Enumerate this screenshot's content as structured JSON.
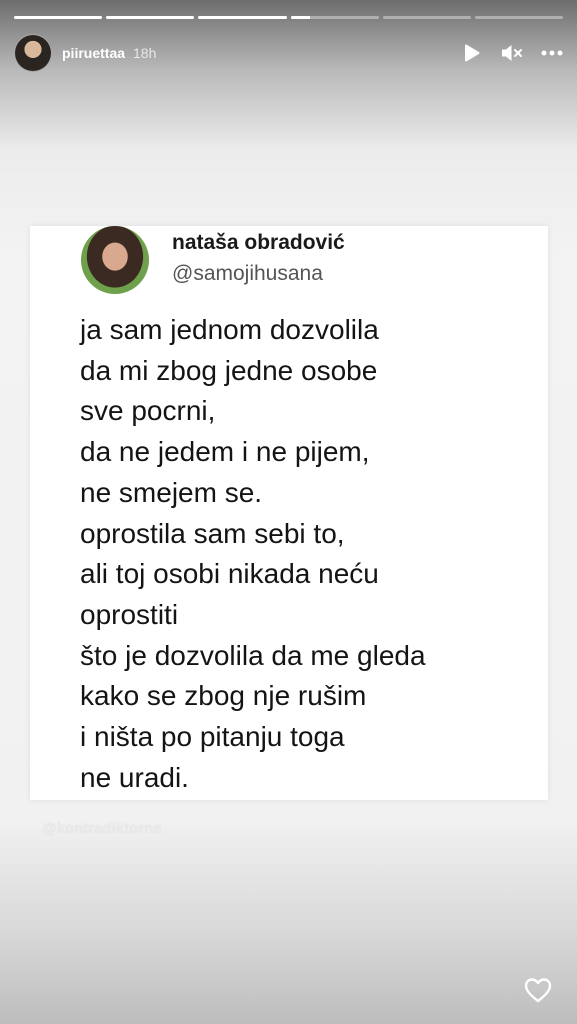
{
  "story": {
    "progress": [
      1,
      1,
      1,
      0.22,
      0,
      0
    ],
    "username": "piiruettaa",
    "time": "18h",
    "icons": [
      "play-icon",
      "mute-icon",
      "more-icon",
      "heart-icon"
    ],
    "watermark": "@kontradiktorne"
  },
  "tweet": {
    "name": "nataša obradović",
    "handle": "@samojihusana",
    "lines": [
      "ja sam jednom dozvolila",
      "da mi zbog jedne osobe",
      "sve pocrni,",
      "da ne jedem i ne pijem,",
      "ne smejem se.",
      "oprostila sam sebi to,",
      "ali toj osobi nikada neću",
      "oprostiti",
      "što je dozvolila da me gleda",
      "kako se zbog nje rušim",
      "i ništa po pitanju toga",
      "ne uradi."
    ]
  }
}
